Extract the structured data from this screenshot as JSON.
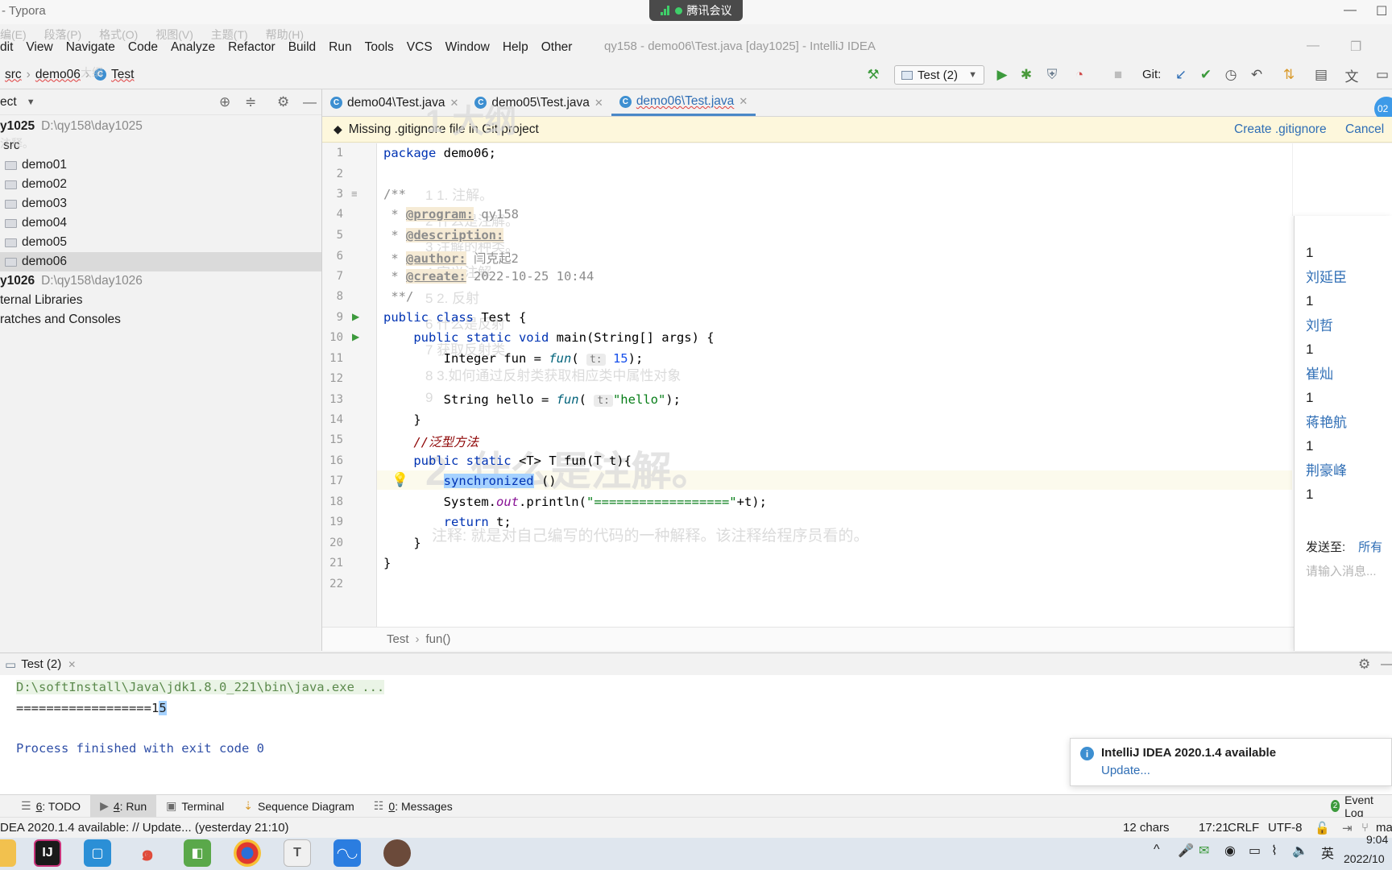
{
  "typora": {
    "title": "- Typora",
    "menu": [
      "编(E)",
      "段落(P)",
      "格式(O)",
      "视图(V)",
      "主题(T)",
      "帮助(H)"
    ]
  },
  "tencent_meeting": {
    "label": "腾讯会议"
  },
  "idea": {
    "title": "qy158 - demo06\\Test.java [day1025] - IntelliJ IDEA",
    "menu": [
      "dit",
      "View",
      "Navigate",
      "Code",
      "Analyze",
      "Refactor",
      "Build",
      "Run",
      "Tools",
      "VCS",
      "Window",
      "Help",
      "Other"
    ]
  },
  "breadcrumb": {
    "src": "src",
    "pkg": "demo06",
    "cls": "Test"
  },
  "run_config": {
    "label": "Test (2)"
  },
  "git_label": "Git:",
  "project": {
    "header": "ect",
    "tree": [
      {
        "label": "y1025",
        "path": "D:\\qy158\\day1025",
        "bold": true
      },
      {
        "label": "src",
        "path": ""
      },
      {
        "label": "demo01",
        "path": "",
        "folder": true
      },
      {
        "label": "demo02",
        "path": "",
        "folder": true
      },
      {
        "label": "demo03",
        "path": "",
        "folder": true
      },
      {
        "label": "demo04",
        "path": "",
        "folder": true
      },
      {
        "label": "demo05",
        "path": "",
        "folder": true
      },
      {
        "label": "demo06",
        "path": "",
        "folder": true,
        "selected": true
      },
      {
        "label": "y1026",
        "path": "D:\\qy158\\day1026",
        "bold": true
      },
      {
        "label": "ternal Libraries",
        "path": ""
      },
      {
        "label": "ratches and Consoles",
        "path": ""
      }
    ]
  },
  "tabs": [
    {
      "label": "demo04\\Test.java",
      "active": false
    },
    {
      "label": "demo05\\Test.java",
      "active": false
    },
    {
      "label": "demo06\\Test.java",
      "active": true
    }
  ],
  "notice": {
    "text": "Missing .gitignore file in Git project",
    "action": "Create .gitignore",
    "cancel": "Cancel"
  },
  "code": {
    "line_numbers": [
      "1",
      "2",
      "3",
      "4",
      "5",
      "6",
      "7",
      "8",
      "9",
      "10",
      "11",
      "12",
      "13",
      "14",
      "15",
      "16",
      "17",
      "18",
      "19",
      "20",
      "21",
      "22"
    ],
    "package_kw": "package",
    "package_name": " demo06;",
    "doc_open": "/**",
    "doc_program_tag": "@program:",
    "doc_program_val": " qy158",
    "doc_description_tag": "@description:",
    "doc_author_tag": "@author:",
    "doc_author_val": " 闫克起2",
    "doc_create_tag": "@create:",
    "doc_create_val": " 2022-10-25 10:44",
    "doc_close": "**/",
    "class_decl_kw": "public class",
    "class_decl_rest": " Test {",
    "main_kw": "public static void",
    "main_rest": " main(String[] args) {",
    "l11_a": "Integer fun = ",
    "l11_fn": "fun",
    "l11_hint": "t:",
    "l11_num": " 15",
    "l11_end": ");",
    "l13_a": "String hello = ",
    "l13_fn": "fun",
    "l13_hint": "t:",
    "l13_str": "\"hello\"",
    "l13_end": ");",
    "l14": "}",
    "l15_comment": "//泛型方法",
    "l16_kw": "public static",
    "l16_rest": " <T> T fun(T t){",
    "l17_kw": "synchronized",
    "l17_rest": " ()",
    "l18_a": "System.",
    "l18_out": "out",
    "l18_b": ".println(",
    "l18_str": "\"==================\"",
    "l18_c": "+t);",
    "l19_kw": "return",
    "l19_rest": " t;",
    "l20": "}",
    "l21": "}"
  },
  "ghost_overlay": {
    "heading": "1 大纲",
    "items": [
      "1  1. 注解。",
      "2   什么是注解。",
      "3   注解的种类。",
      "4   定义注解",
      "5  2. 反射",
      "6   什么是反射",
      "7   获取反射类",
      "8       3.如何通过反射类获取相应类中属性对象",
      "9"
    ],
    "big": "2. 什么是注解。",
    "sentence": "注释: 就是对自己编写的代码的一种解释。该注释给程序员看的。",
    "side_1": "大纲",
    "side_2": "注释。"
  },
  "editor_crumb": {
    "cls": "Test",
    "method": "fun()"
  },
  "chat": {
    "entries": [
      {
        "num": "1",
        "name": "刘延臣"
      },
      {
        "num": "1",
        "name": "刘哲"
      },
      {
        "num": "1",
        "name": "崔灿"
      },
      {
        "num": "1",
        "name": "蒋艳航"
      },
      {
        "num": "1",
        "name": "荆豪峰"
      },
      {
        "num": "1",
        "name": ""
      }
    ],
    "send_to": "发送至:",
    "send_all": "所有",
    "placeholder": "请输入消息...",
    "avatar": "02"
  },
  "run_panel": {
    "tab": "Test (2)",
    "cmd": "D:\\softInstall\\Java\\jdk1.8.0_221\\bin\\java.exe ...",
    "out_prefix": "==================1",
    "out_sel": "5",
    "finished": "Process finished with exit code 0"
  },
  "notification": {
    "title": "IntelliJ IDEA 2020.1.4 available",
    "link": "Update..."
  },
  "tool_windows": [
    {
      "num": "6",
      "label": ": TODO"
    },
    {
      "num": "4",
      "label": ": Run"
    },
    {
      "num": "",
      "label": "Terminal"
    },
    {
      "num": "",
      "label": "Sequence Diagram"
    },
    {
      "num": "0",
      "label": ": Messages"
    }
  ],
  "event_log": {
    "count": "2",
    "label": "Event Log"
  },
  "status": {
    "message": "DEA 2020.1.4 available: // Update... (yesterday 21:10)",
    "chars": "12 chars",
    "pos": "17:21",
    "eol": "CRLF",
    "enc": "UTF-8",
    "branch": "ma"
  },
  "taskbar": {
    "ime": "英",
    "time": "9:04",
    "date": "2022/10"
  }
}
